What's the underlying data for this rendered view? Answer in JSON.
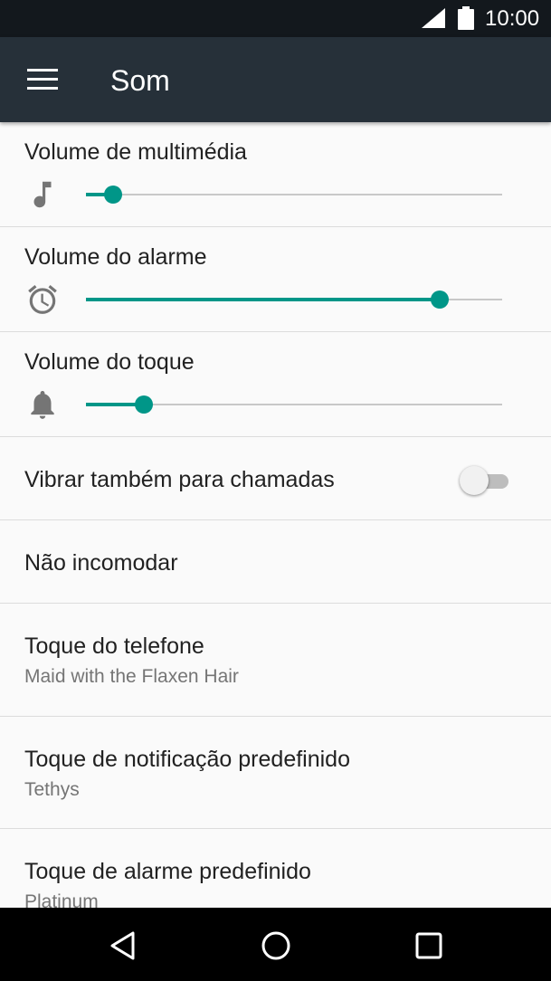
{
  "status_bar": {
    "time": "10:00",
    "icons": [
      "signal-icon",
      "battery-icon"
    ]
  },
  "app_bar": {
    "menu_icon": "hamburger-menu-icon",
    "title": "Som"
  },
  "settings": {
    "media_volume": {
      "label": "Volume de multimédia",
      "icon": "music-note-icon",
      "level": 0.065
    },
    "alarm_volume": {
      "label": "Volume do alarme",
      "icon": "alarm-clock-icon",
      "level": 0.85
    },
    "ring_volume": {
      "label": "Volume do toque",
      "icon": "bell-icon",
      "level": 0.14
    },
    "vibrate": {
      "label": "Vibrar também para chamadas",
      "enabled": false
    },
    "do_not_disturb": {
      "label": "Não incomodar"
    },
    "phone_ringtone": {
      "label": "Toque do telefone",
      "value": "Maid with the Flaxen Hair"
    },
    "notification_sound": {
      "label": "Toque de notificação predefinido",
      "value": "Tethys"
    },
    "alarm_sound": {
      "label": "Toque de alarme predefinido",
      "value": "Platinum"
    }
  },
  "colors": {
    "accent": "#009688",
    "app_bar": "#263039",
    "status_bar": "#13181d",
    "background": "#fafafa"
  },
  "nav_bar": {
    "icons": [
      "back-icon",
      "home-icon",
      "recents-icon"
    ]
  }
}
